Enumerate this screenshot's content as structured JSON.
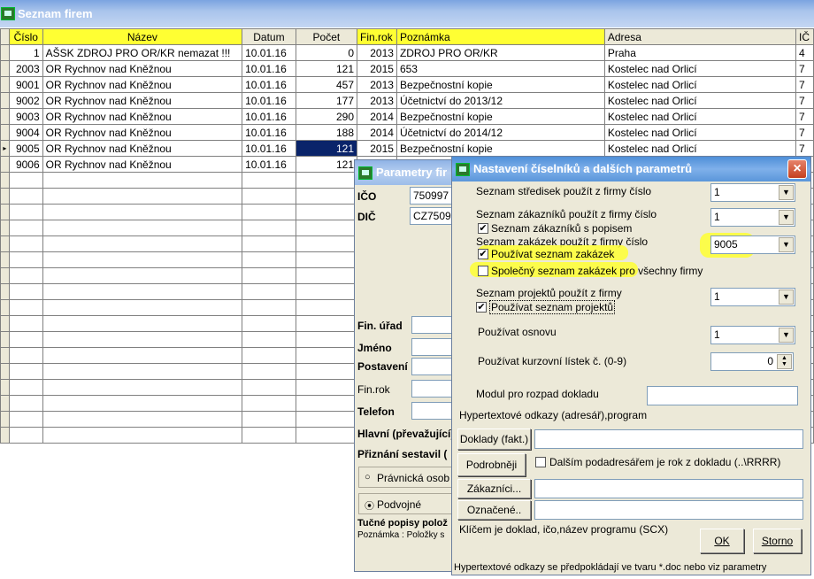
{
  "main_window": {
    "title": "Seznam firem"
  },
  "grid": {
    "columns": [
      "Číslo",
      "Název",
      "Datum",
      "Počet",
      "Fin.rok",
      "Poznámka",
      "Adresa",
      "IČ"
    ],
    "rows": [
      [
        "1",
        "AŠSK ZDROJ PRO OR/KR nemazat !!!",
        "10.01.16",
        "0",
        "2013",
        "ZDROJ PRO OR/KR",
        "Praha",
        "4"
      ],
      [
        "2003",
        "OR Rychnov nad Kněžnou",
        "10.01.16",
        "121",
        "2015",
        "653",
        "Kostelec nad Orlicí",
        "7"
      ],
      [
        "9001",
        "OR Rychnov nad Kněžnou",
        "10.01.16",
        "457",
        "2013",
        "Bezpečnostní kopie",
        "Kostelec nad Orlicí",
        "7"
      ],
      [
        "9002",
        "OR Rychnov nad Kněžnou",
        "10.01.16",
        "177",
        "2013",
        "Účetnictví do 2013/12",
        "Kostelec nad Orlicí",
        "7"
      ],
      [
        "9003",
        "OR Rychnov nad Kněžnou",
        "10.01.16",
        "290",
        "2014",
        "Bezpečnostní kopie",
        "Kostelec nad Orlicí",
        "7"
      ],
      [
        "9004",
        "OR Rychnov nad Kněžnou",
        "10.01.16",
        "188",
        "2014",
        "Účetnictví do 2014/12",
        "Kostelec nad Orlicí",
        "7"
      ],
      [
        "9005",
        "OR Rychnov nad Kněžnou",
        "10.01.16",
        "121",
        "2015",
        "Bezpečnostní kopie",
        "Kostelec nad Orlicí",
        "7"
      ],
      [
        "9006",
        "OR Rychnov nad Kněžnou",
        "10.01.16",
        "121",
        "",
        "",
        "",
        ""
      ]
    ],
    "current_row_marker": "▸"
  },
  "params_window": {
    "title": "Parametry fir",
    "ico_label": "IČO",
    "ico_value": "750997",
    "dic_label": "DIČ",
    "dic_value": "CZ7509",
    "fin_urad_label": "Fin. úřad",
    "jmeno_label": "Jméno",
    "postaveni_label": "Postavení",
    "finrok_label": "Fin.rok",
    "telefon_label": "Telefon",
    "hlavni_label": "Hlavní (převažující)",
    "priznani_label": "Přiznání sestavil (",
    "pravnicka_label": "Právnická osob",
    "podvojne_label": "Podvojné",
    "tucne_label": "Tučné popisy polož",
    "poznamka_label": "Poznámka : Položky s"
  },
  "settings_dialog": {
    "title": "Nastavení číselníků a dalších parametrů",
    "strediska_label": "Seznam středisek  použít z firmy číslo",
    "strediska_value": "1",
    "zakaznici_label": "Seznam zákazníků  použít z firmy číslo",
    "zakaznici_value": "1",
    "zakaznici_popis_label": "Seznam zákazníků s popisem",
    "zakazky_label": "Seznam zakázek použít z firmy číslo",
    "zakazky_value": "9005",
    "pouzivat_zakazky_label": "Používat seznam zakázek",
    "spolecny_label": "Společný seznam zakázek pro všechny firmy",
    "projekty_label": "Seznam projektů použít z firmy",
    "projekty_value": "1",
    "pouzivat_projekty_label": "Používat seznam projektů",
    "osnova_label": "Používat osnovu",
    "osnova_value": "1",
    "kurz_label": "Používat kurzovní lístek č. (0-9)",
    "kurz_value": "0",
    "modul_label": "Modul pro rozpad dokladu",
    "hyper_label": "Hypertextové odkazy (adresář),program",
    "doklady_button": "Doklady (fakt.)",
    "podrobneji_button": "Podrobněji",
    "podadresar_label": "Dalším podadresářem je rok z dokladu (..\\RRRR)",
    "zakaznici_button": "Zákazníci...",
    "oznacene_button": "Označené..",
    "klicem_label": "Klíčem  je doklad, ičo,název programu (SCX)",
    "ok_button": "OK",
    "storno_button": "Storno",
    "footer_label": "Hypertextové odkazy  se předpokládají ve  tvaru  *.doc nebo viz parametry"
  },
  "colors": {
    "header_yellow": "#ffff33",
    "selection": "#0a246a",
    "highlight": "#ffff33"
  }
}
